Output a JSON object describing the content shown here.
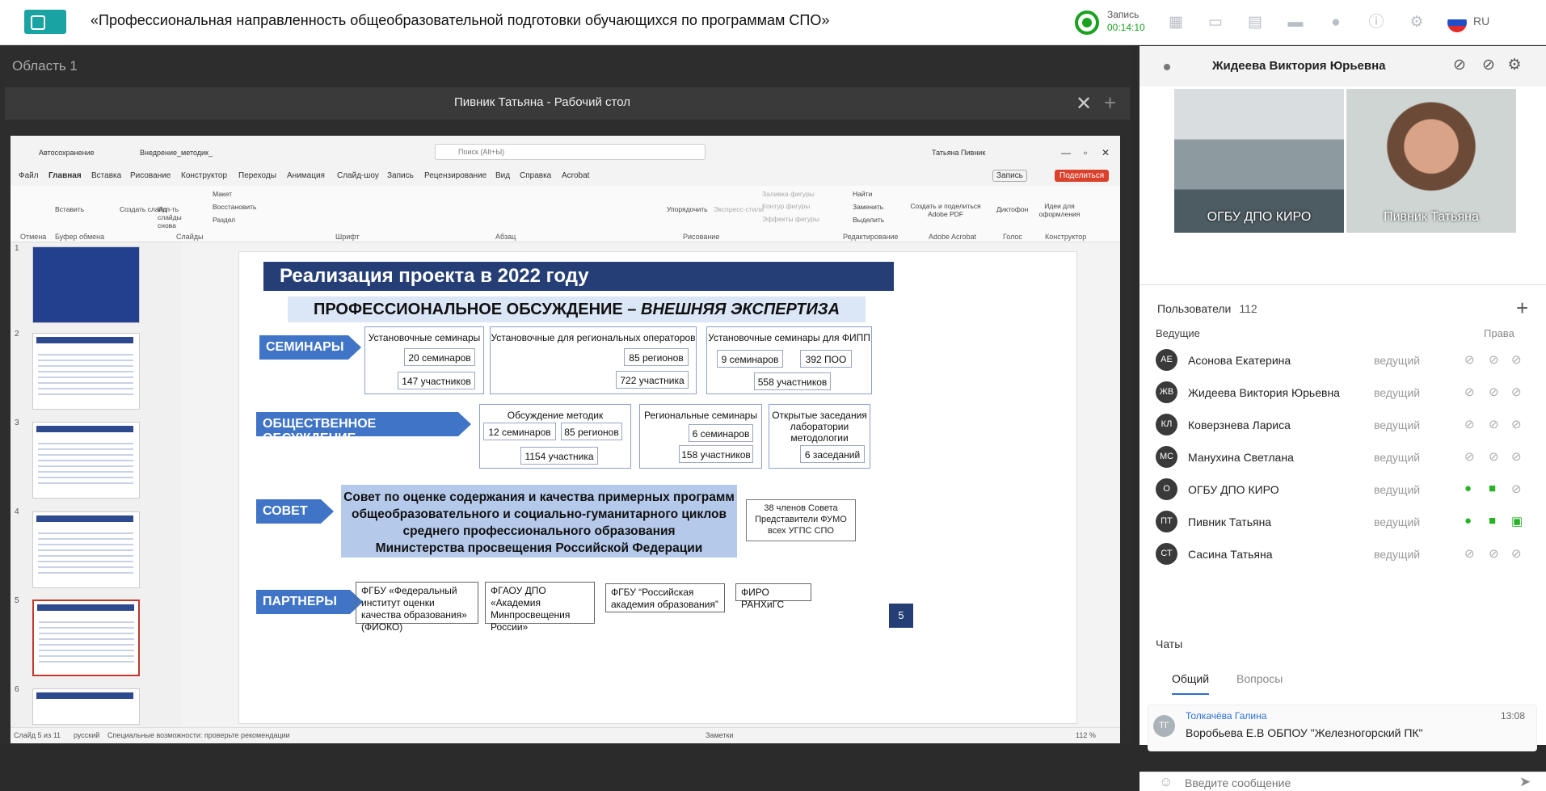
{
  "app": {
    "title": "«Профессиональная направленность общеобразовательной подготовки обучающихся по программам СПО»",
    "rec_label": "Запись",
    "rec_time": "00:14:10",
    "lang": "RU"
  },
  "left": {
    "area": "Область 1",
    "window_title": "Пивник Татьяна - Рабочий стол"
  },
  "ppt": {
    "autosave": "Автосохранение",
    "filename": "Внедрение_методик_",
    "search": "Поиск (Alt+Ы)",
    "user": "Татьяна Пивник",
    "menu": [
      "Файл",
      "Главная",
      "Вставка",
      "Рисование",
      "Конструктор",
      "Переходы",
      "Анимация",
      "Слайд-шоу",
      "Запись",
      "Рецензирование",
      "Вид",
      "Справка",
      "Acrobat"
    ],
    "record_btn": "Запись",
    "share_btn": "Поделиться",
    "groups": [
      "Отмена",
      "Буфер обмена",
      "Слайды",
      "Шрифт",
      "Абзац",
      "Рисование",
      "Редактирование",
      "Adobe Acrobat",
      "Голос",
      "Конструктор"
    ],
    "labels": [
      "Вставить",
      "Создать слайд",
      "Исп-ть слайды снова",
      "Макет",
      "Восстановить",
      "Раздел",
      "Упорядочить",
      "Экспресс-стили",
      "Заливка фигуры",
      "Контур фигуры",
      "Эффекты фигуры",
      "Найти",
      "Заменить",
      "Выделить",
      "Создать и поделиться Adobe PDF",
      "Диктофон",
      "Идеи для оформления"
    ],
    "thumb_nums": [
      "1",
      "2",
      "3",
      "4",
      "5",
      "6"
    ],
    "status_slide": "Слайд 5 из 11",
    "status_lang": "русский",
    "status_access": "Специальные возможности: проверьте рекомендации",
    "status_notes": "Заметки",
    "zoom": "112 %"
  },
  "slide": {
    "title": "Реализация проекта в 2022 году",
    "subtitle_a": "ПРОФЕССИОНАЛЬНОЕ ОБСУЖДЕНИЕ – ",
    "subtitle_b": "ВНЕШНЯЯ ЭКСПЕРТИЗА",
    "row1": {
      "label": "СЕМИНАРЫ",
      "b1": {
        "h": "Установочные семинары",
        "p1": "20 семинаров",
        "p2": "147 участников"
      },
      "b2": {
        "h": "Установочные для региональных операторов",
        "p1": "85 регионов",
        "p2": "722 участника"
      },
      "b3": {
        "h": "Установочные семинары для ФИПП",
        "p1": "9 семинаров",
        "p2": "392 ПОО",
        "p3": "558 участников"
      }
    },
    "row2": {
      "label": "ОБЩЕСТВЕННОЕ ОБСУЖДЕНИЕ",
      "b1": {
        "h": "Обсуждение методик",
        "p1": "12 семинаров",
        "p2": "85 регионов",
        "p3": "1154 участника"
      },
      "b2": {
        "h": "Региональные семинары",
        "p1": "6 семинаров",
        "p2": "158 участников"
      },
      "b3": {
        "h1": "Открытые заседания",
        "h2": "лаборатории",
        "h3": "методологии",
        "p1": "6 заседаний"
      }
    },
    "row3": {
      "label": "СОВЕТ",
      "l1": "Совет по оценке содержания и качества примерных программ",
      "l2": "общеобразовательного и социально-гуманитарного циклов",
      "l3": "среднего профессионального образования",
      "l4": "Министерства просвещения Российской Федерации",
      "m1": "38 членов Совета",
      "m2": "Представители ФУМО",
      "m3": "всех УГПС СПО"
    },
    "row4": {
      "label": "ПАРТНЕРЫ",
      "p1": "ФГБУ «Федеральный институт оценки качества образования» (ФИОКО)",
      "p2": "ФГАОУ ДПО «Академия Минпросвещения России»",
      "p3": "ФГБУ “Российская академия образования”",
      "p4": "ФИРО РАНХиГС"
    },
    "page": "5"
  },
  "right": {
    "speaker": "Жидеева Виктория Юрьевна",
    "video1": "ОГБУ ДПО КИРО",
    "video2": "Пивник Татьяна",
    "users_label": "Пользователи",
    "users_count": "112",
    "leading": "Ведущие",
    "rights": "Права",
    "users": [
      {
        "initials": "АЕ",
        "name": "Асонова Екатерина",
        "role": "ведущий",
        "active": false
      },
      {
        "initials": "ЖВ",
        "name": "Жидеева Виктория Юрьевна",
        "role": "ведущий",
        "active": false
      },
      {
        "initials": "КЛ",
        "name": "Коверзнева Лариса",
        "role": "ведущий",
        "active": false
      },
      {
        "initials": "МС",
        "name": "Манухина Светлана",
        "role": "ведущий",
        "active": false
      },
      {
        "initials": "О",
        "name": "ОГБУ ДПО КИРО",
        "role": "ведущий",
        "active": true
      },
      {
        "initials": "ПТ",
        "name": "Пивник Татьяна",
        "role": "ведущий",
        "active": true
      },
      {
        "initials": "СТ",
        "name": "Сасина Татьяна",
        "role": "ведущий",
        "active": false
      }
    ],
    "chats": "Чаты",
    "tab_general": "Общий",
    "tab_questions": "Вопросы",
    "message": {
      "initials": "ТГ",
      "author": "Толкачёва Галина",
      "time": "13:08",
      "text": "Воробьева Е.В ОБПОУ \"Железногорский ПК\""
    },
    "input_placeholder": "Введите сообщение",
    "colors": {
      "accent": "#2b6fd6",
      "green": "#28b327",
      "slide_blue": "#253f76"
    }
  }
}
